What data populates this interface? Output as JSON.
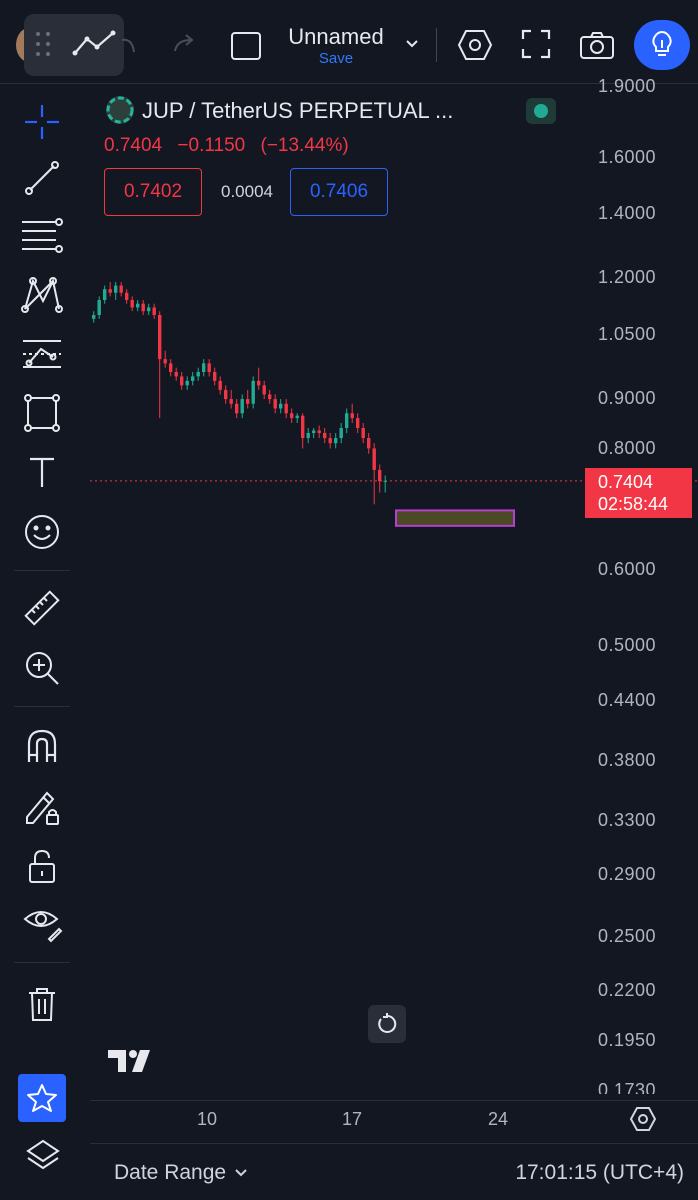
{
  "topbar": {
    "chart_name": "Unnamed",
    "save_label": "Save",
    "icons": [
      "drag-handle-icon",
      "trend-line-icon",
      "undo-icon",
      "redo-icon",
      "layout-icon",
      "chevron-down-icon",
      "settings-hexagon-icon",
      "fullscreen-icon",
      "camera-icon",
      "lightbulb-icon"
    ]
  },
  "left_toolbar": {
    "icons": [
      "crosshair-icon",
      "line-tool-icon",
      "fib-levels-icon",
      "pattern-icon",
      "projection-icon",
      "rectangle-icon",
      "text-icon",
      "emoji-icon",
      "ruler-icon",
      "zoom-in-icon",
      "magnet-icon",
      "lock-drawing-icon",
      "unlock-icon",
      "eye-icon",
      "trash-icon",
      "star-icon",
      "layers-icon"
    ]
  },
  "legend": {
    "symbol": "JUP / TetherUS PERPETUAL ...",
    "last_price": "0.7404",
    "change": "−0.1150",
    "change_pct": "(−13.44%)",
    "sell_price": "0.7402",
    "spread": "0.0004",
    "buy_price": "0.7406"
  },
  "colors": {
    "background": "#131722",
    "up": "#22ab94",
    "down": "#f23645",
    "accent": "#2962ff",
    "zone_fill": "#4b4a24",
    "zone_border": "#b43fd0"
  },
  "price_scale": {
    "labels": [
      "1.9000",
      "1.6000",
      "1.4000",
      "1.2000",
      "1.0500",
      "0.9000",
      "0.8000",
      "0.6000",
      "0.5000",
      "0.4400",
      "0.3800",
      "0.3300",
      "0.2900",
      "0.2500",
      "0.2200",
      "0.1950",
      "0.1730"
    ],
    "last_price": "0.7404",
    "countdown": "02:58:44",
    "log_scale": true
  },
  "time_axis": {
    "labels": [
      "10",
      "17",
      "24"
    ]
  },
  "bottom_bar": {
    "date_range": "Date Range",
    "clock": "17:01:15 (UTC+4)"
  },
  "chart_data": {
    "type": "candlestick",
    "y_scale": "log",
    "ylim": [
      0.17,
      1.95
    ],
    "last_price_line": 0.7404,
    "zone": {
      "top": 0.69,
      "bottom": 0.665
    },
    "ohlc": [
      [
        1.09,
        1.11,
        1.08,
        1.1
      ],
      [
        1.1,
        1.15,
        1.09,
        1.14
      ],
      [
        1.14,
        1.18,
        1.13,
        1.17
      ],
      [
        1.17,
        1.19,
        1.15,
        1.16
      ],
      [
        1.16,
        1.19,
        1.14,
        1.18
      ],
      [
        1.18,
        1.19,
        1.15,
        1.16
      ],
      [
        1.16,
        1.17,
        1.13,
        1.14
      ],
      [
        1.14,
        1.15,
        1.11,
        1.12
      ],
      [
        1.12,
        1.14,
        1.11,
        1.13
      ],
      [
        1.13,
        1.14,
        1.1,
        1.11
      ],
      [
        1.11,
        1.13,
        1.1,
        1.12
      ],
      [
        1.12,
        1.13,
        1.09,
        1.1
      ],
      [
        1.1,
        1.11,
        0.86,
        0.99
      ],
      [
        0.99,
        1.01,
        0.97,
        0.98
      ],
      [
        0.98,
        0.99,
        0.95,
        0.96
      ],
      [
        0.96,
        0.97,
        0.94,
        0.95
      ],
      [
        0.95,
        0.96,
        0.92,
        0.93
      ],
      [
        0.93,
        0.95,
        0.92,
        0.94
      ],
      [
        0.94,
        0.96,
        0.93,
        0.95
      ],
      [
        0.95,
        0.97,
        0.94,
        0.96
      ],
      [
        0.96,
        0.99,
        0.95,
        0.98
      ],
      [
        0.98,
        0.99,
        0.95,
        0.96
      ],
      [
        0.96,
        0.97,
        0.93,
        0.94
      ],
      [
        0.94,
        0.95,
        0.91,
        0.92
      ],
      [
        0.92,
        0.93,
        0.89,
        0.9
      ],
      [
        0.9,
        0.92,
        0.88,
        0.89
      ],
      [
        0.89,
        0.9,
        0.86,
        0.87
      ],
      [
        0.87,
        0.91,
        0.86,
        0.9
      ],
      [
        0.9,
        0.92,
        0.88,
        0.89
      ],
      [
        0.89,
        0.95,
        0.88,
        0.94
      ],
      [
        0.94,
        0.97,
        0.92,
        0.93
      ],
      [
        0.93,
        0.94,
        0.9,
        0.91
      ],
      [
        0.91,
        0.92,
        0.89,
        0.9
      ],
      [
        0.9,
        0.91,
        0.87,
        0.88
      ],
      [
        0.88,
        0.9,
        0.87,
        0.89
      ],
      [
        0.89,
        0.9,
        0.86,
        0.87
      ],
      [
        0.87,
        0.88,
        0.85,
        0.86
      ],
      [
        0.86,
        0.87,
        0.85,
        0.865
      ],
      [
        0.865,
        0.87,
        0.8,
        0.82
      ],
      [
        0.82,
        0.84,
        0.81,
        0.83
      ],
      [
        0.83,
        0.84,
        0.82,
        0.835
      ],
      [
        0.835,
        0.845,
        0.82,
        0.83
      ],
      [
        0.83,
        0.84,
        0.81,
        0.82
      ],
      [
        0.82,
        0.83,
        0.8,
        0.81
      ],
      [
        0.81,
        0.83,
        0.8,
        0.82
      ],
      [
        0.82,
        0.85,
        0.81,
        0.84
      ],
      [
        0.84,
        0.88,
        0.83,
        0.87
      ],
      [
        0.87,
        0.89,
        0.85,
        0.86
      ],
      [
        0.86,
        0.87,
        0.83,
        0.84
      ],
      [
        0.84,
        0.85,
        0.81,
        0.82
      ],
      [
        0.82,
        0.83,
        0.79,
        0.8
      ],
      [
        0.8,
        0.81,
        0.7,
        0.76
      ],
      [
        0.76,
        0.77,
        0.72,
        0.74
      ],
      [
        0.74,
        0.75,
        0.72,
        0.7404
      ]
    ]
  }
}
